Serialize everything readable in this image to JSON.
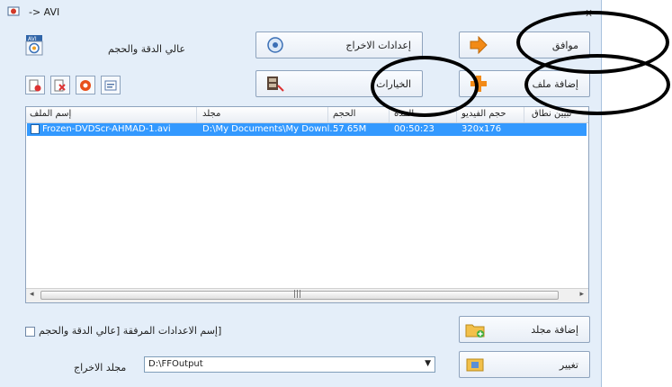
{
  "window": {
    "title": "-> AVI",
    "close_glyph": "x"
  },
  "profile": {
    "quality_label": "عالي الدقة والحجم",
    "icon": "avi-profile-icon"
  },
  "buttons": {
    "output_settings": "إعدادات الاخراج",
    "ok": "موافق",
    "options": "الخيارات",
    "add_file": "إضافة ملف",
    "add_folder": "إضافة مجلد",
    "change": "تغيير"
  },
  "toolbar_icons": [
    "remove-file-icon",
    "clear-list-icon",
    "play-icon",
    "media-info-icon"
  ],
  "list": {
    "columns": [
      "إسم الملف",
      "مجلد",
      "الحجم",
      "المدة",
      "حجم الفيديو",
      "تبيين نطاق"
    ],
    "rows": [
      {
        "name": "Frozen-DVDScr-AHMAD-1.avi",
        "folder": "D:\\My Documents\\My Downl...",
        "size": "57.65M",
        "duration": "00:50:23",
        "video_size": "320x176",
        "range": ""
      }
    ],
    "scroll_grip": "|||"
  },
  "attach_label": "[إسم الاعدادات المرفقة [عالي الدقة والحجم",
  "output": {
    "label": "مجلد الاخراج",
    "value": "D:\\FFOutput"
  },
  "colors": {
    "window_bg": "#e4eef9",
    "selection": "#3399ff",
    "arrow_orange": "#f28a17"
  }
}
